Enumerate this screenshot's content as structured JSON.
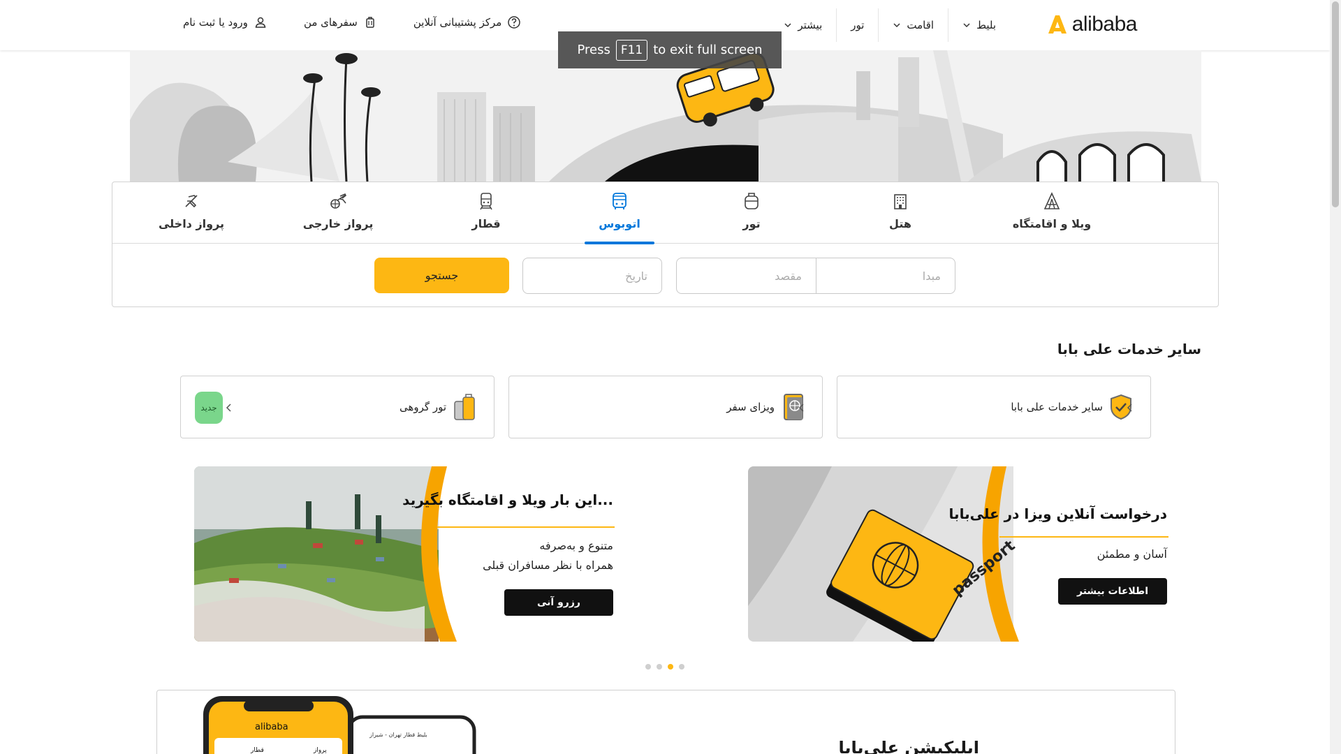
{
  "header": {
    "logo_text": "alibaba",
    "nav": [
      {
        "label": "بلیط",
        "has_dropdown": true
      },
      {
        "label": "اقامت",
        "has_dropdown": true
      },
      {
        "label": "تور",
        "has_dropdown": false
      },
      {
        "label": "بیشتر",
        "has_dropdown": true
      }
    ],
    "support_label": "مرکز پشتیبانی آنلاین",
    "trips_label": "سفرهای من",
    "login_label": "ورود یا ثبت نام"
  },
  "toast": {
    "press": "Press",
    "key": "F11",
    "rest": "to exit full screen"
  },
  "tabs": [
    {
      "label": "پرواز داخلی",
      "icon": "plane-icon",
      "active": false
    },
    {
      "label": "پرواز خارجی",
      "icon": "globe-plane-icon",
      "active": false
    },
    {
      "label": "قطار",
      "icon": "train-icon",
      "active": false
    },
    {
      "label": "اتوبوس",
      "icon": "bus-icon",
      "active": true
    },
    {
      "label": "تور",
      "icon": "suitcase-icon",
      "active": false
    },
    {
      "label": "هتل",
      "icon": "hotel-icon",
      "active": false
    },
    {
      "label": "ویلا و اقامتگاه",
      "icon": "villa-icon",
      "active": false
    }
  ],
  "search": {
    "origin_placeholder": "مبدا",
    "destination_placeholder": "مقصد",
    "date_placeholder": "تاریخ",
    "button_label": "جستجو"
  },
  "services": {
    "title": "سایر خدمات علی بابا",
    "items": [
      {
        "label": "سایر خدمات علی بابا",
        "icon": "shield-check-icon"
      },
      {
        "label": "ویزای سفر",
        "icon": "passport-globe-icon"
      },
      {
        "label": "تور گروهی",
        "icon": "luggage-icon",
        "badge": "جدید"
      }
    ]
  },
  "banners": [
    {
      "title": "درخواست آنلاین ویزا در علی‌بابا",
      "lines": [
        "آسان و مطمئن"
      ],
      "button": "اطلاعات بیشتر",
      "art_text": "passport"
    },
    {
      "title": "این بار ویلا و اقامتگاه بگیرید...",
      "lines": [
        "متنوع و به‌صرفه",
        "همراه با نظر مسافران قبلی"
      ],
      "button": "رزرو آنی"
    }
  ],
  "carousel": {
    "count": 4,
    "active_index": 2
  },
  "app_section": {
    "title": "اپلیکیشن علی‌بابا",
    "phone_logo": "alibaba",
    "phone_tabs": [
      "پرواز",
      "قطار"
    ],
    "phone2_route": "بلیط قطار تهران - شیراز"
  },
  "colors": {
    "accent": "#fdb713",
    "active_tab": "#0077db",
    "text": "#1a1a1a"
  }
}
